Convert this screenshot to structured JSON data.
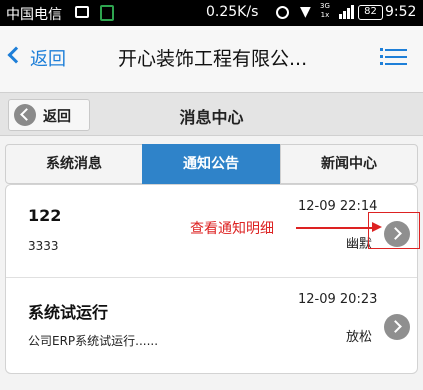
{
  "status_bar": {
    "carrier": "中国电信",
    "speed": "0.25K/s",
    "net_label": "3G\n1x",
    "battery": "82",
    "time": "9:52"
  },
  "navbar": {
    "back_label": "返回",
    "title": "开心装饰工程有限公..."
  },
  "subheader": {
    "back_label": "返回",
    "title": "消息中心"
  },
  "tabs": [
    {
      "label": "系统消息",
      "active": false
    },
    {
      "label": "通知公告",
      "active": true
    },
    {
      "label": "新闻中心",
      "active": false
    }
  ],
  "items": [
    {
      "title": "122",
      "subtitle": "3333",
      "time": "12-09 22:14",
      "author": "幽默"
    },
    {
      "title": "系统试运行",
      "subtitle": "公司ERP系统试运行......",
      "time": "12-09 20:23",
      "author": "放松"
    }
  ],
  "annotation": {
    "text": "查看通知明细",
    "color": "#dd2222"
  },
  "colors": {
    "accent": "#1e7fd8",
    "active_tab": "#2f83c9"
  }
}
